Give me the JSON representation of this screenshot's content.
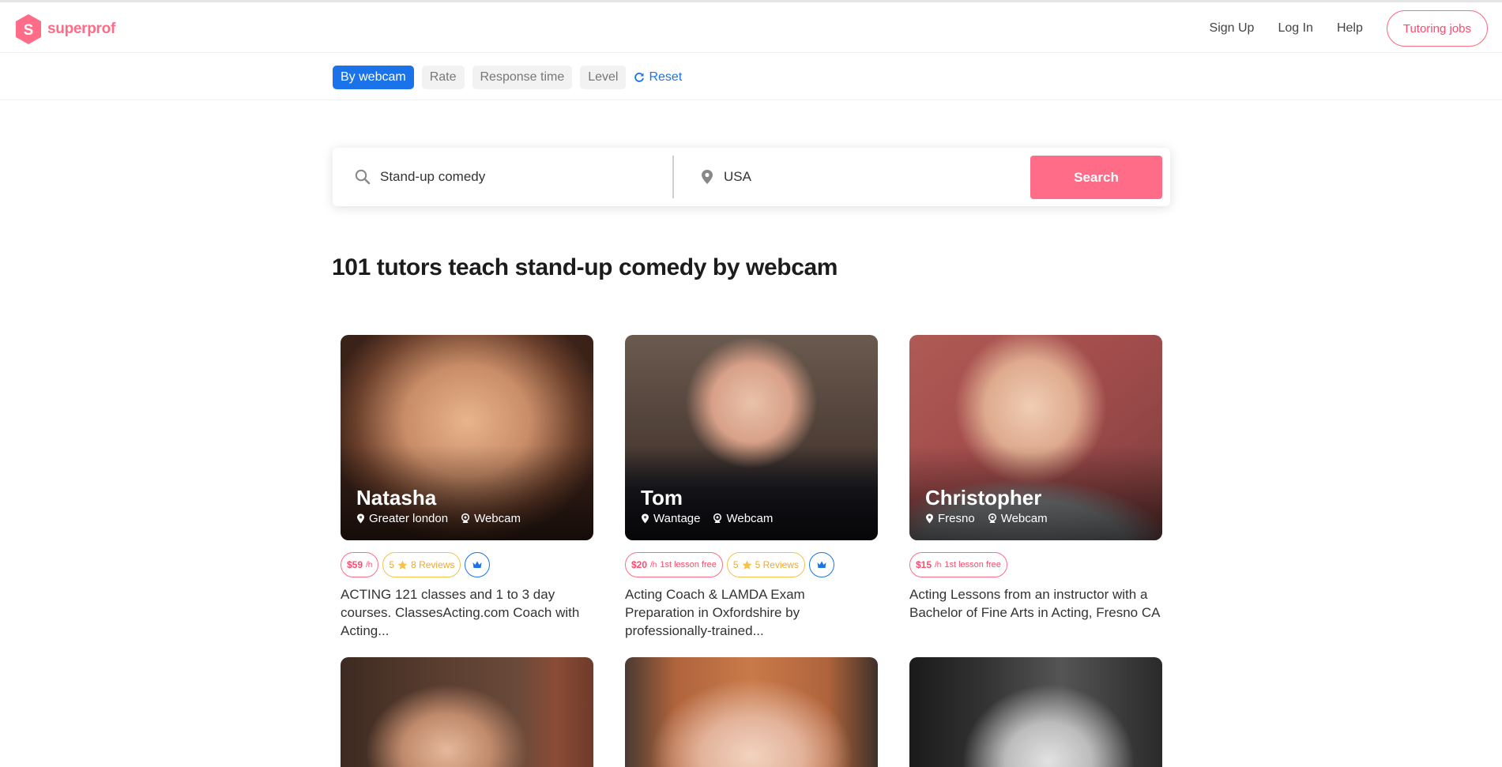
{
  "header": {
    "brand": "superprof",
    "logo_letter": "S",
    "nav": [
      "Sign Up",
      "Log In",
      "Help"
    ],
    "tutoring_jobs": "Tutoring jobs"
  },
  "filters": {
    "chips": [
      "By webcam",
      "Rate",
      "Response time",
      "Level"
    ],
    "reset": "Reset"
  },
  "search": {
    "subject": "Stand-up comedy",
    "location": "USA",
    "button": "Search"
  },
  "title": "101 tutors teach stand-up comedy by webcam",
  "tutors": [
    {
      "name": "Natasha",
      "location": "Greater london",
      "mode": "Webcam",
      "price": "$59",
      "unit": "/h",
      "rating": "5",
      "reviews": "8 Reviews",
      "description": "ACTING 121 classes and 1 to 3 day courses. ClassesActing.com Coach with Acting..."
    },
    {
      "name": "Tom",
      "location": "Wantage",
      "mode": "Webcam",
      "price": "$20",
      "unit": "/h",
      "first_lesson": "1st lesson free",
      "rating": "5",
      "reviews": "5 Reviews",
      "description": "Acting Coach & LAMDA Exam Preparation in Oxfordshire by professionally-trained..."
    },
    {
      "name": "Christopher",
      "location": "Fresno",
      "mode": "Webcam",
      "price": "$15",
      "unit": "/h",
      "first_lesson": "1st lesson free",
      "description": "Acting Lessons from an instructor with a Bachelor of Fine Arts in Acting, Fresno CA"
    }
  ],
  "colors": {
    "brand": "#ff6c87",
    "accent": "#1a73e8",
    "star": "#f6c24d"
  }
}
